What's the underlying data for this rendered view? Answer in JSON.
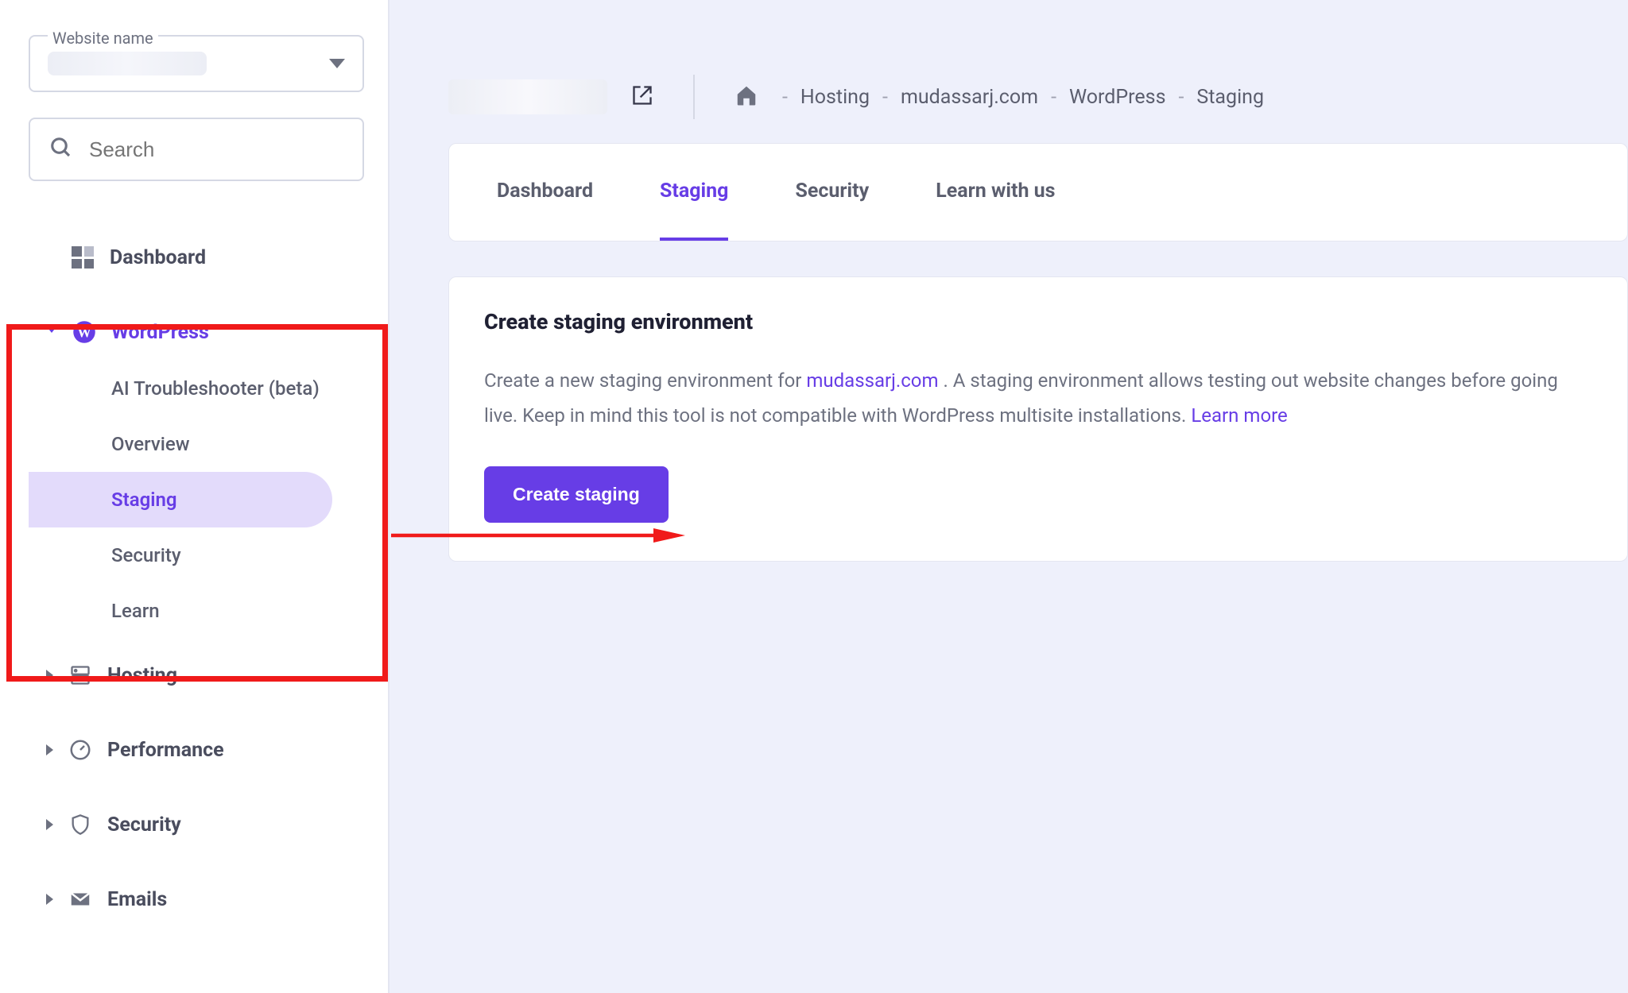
{
  "sidebar": {
    "website_label": "Website name",
    "search_placeholder": "Search",
    "items": [
      {
        "label": "Dashboard"
      },
      {
        "label": "WordPress",
        "children": [
          {
            "label": "AI Troubleshooter (beta)"
          },
          {
            "label": "Overview"
          },
          {
            "label": "Staging"
          },
          {
            "label": "Security"
          },
          {
            "label": "Learn"
          }
        ]
      },
      {
        "label": "Hosting"
      },
      {
        "label": "Performance"
      },
      {
        "label": "Security"
      },
      {
        "label": "Emails"
      }
    ]
  },
  "breadcrumb": {
    "parts": [
      "Hosting",
      "mudassarj.com",
      "WordPress",
      "Staging"
    ],
    "sep": "-"
  },
  "tabs": [
    {
      "label": "Dashboard"
    },
    {
      "label": "Staging"
    },
    {
      "label": "Security"
    },
    {
      "label": "Learn with us"
    }
  ],
  "panel": {
    "title": "Create staging environment",
    "desc_pre": "Create a new staging environment for ",
    "domain": "mudassarj.com",
    "desc_mid": " . A staging environment allows testing out website changes before going live. Keep in mind this tool is not compatible with WordPress multisite installations. ",
    "learn_more": "Learn more",
    "button": "Create staging"
  }
}
